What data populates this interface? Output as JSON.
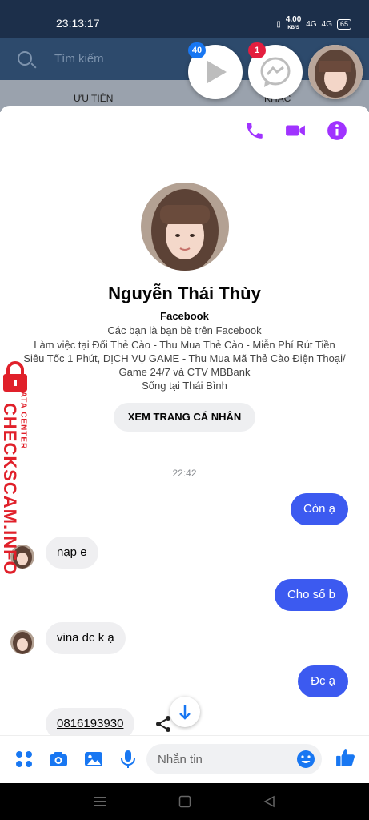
{
  "status": {
    "time": "23:13:17",
    "net_speed": "4.00",
    "net_unit": "KB/S",
    "signal1": "4G",
    "signal2": "4G",
    "battery": "65"
  },
  "background": {
    "search_placeholder": "Tìm kiếm",
    "tab_priority": "ƯU TIÊN",
    "tab_other": "KHÁC"
  },
  "chat_heads": {
    "video_badge": "40",
    "messenger_badge": "1"
  },
  "profile": {
    "name": "Nguyễn Thái Thùy",
    "platform": "Facebook",
    "friends_line": "Các bạn là bạn bè trên Facebook",
    "work_line1": "Làm việc tại Đổi Thẻ Cào - Thu Mua Thẻ Cào - Miễn Phí Rút Tiền",
    "work_line2": "Siêu Tốc 1 Phút, DỊCH VỤ GAME - Thu Mua Mã Thẻ Cào Điện Thoại/",
    "work_line3": "Game 24/7 và CTV MBBank",
    "lives_line": "Sống tại Thái Bình",
    "view_profile_label": "XEM TRANG CÁ NHÂN"
  },
  "conversation": {
    "timestamp": "22:42",
    "messages": [
      {
        "dir": "out",
        "text": "Còn ạ"
      },
      {
        "dir": "in",
        "text": "nạp e"
      },
      {
        "dir": "out",
        "text": "Cho số b"
      },
      {
        "dir": "in",
        "text": "vina dc k ạ"
      },
      {
        "dir": "out",
        "text": "Đc ạ"
      },
      {
        "dir": "in",
        "text": "0816193930"
      }
    ]
  },
  "composer": {
    "placeholder": "Nhắn tin"
  },
  "watermark": {
    "brand": "CHECKSCAM.INFO",
    "sub": "DATA CENTER"
  },
  "colors": {
    "accent": "#3c5af0",
    "header_icons": "#a033ff",
    "composer_icons": "#1877f2",
    "watermark": "#e0202a"
  }
}
